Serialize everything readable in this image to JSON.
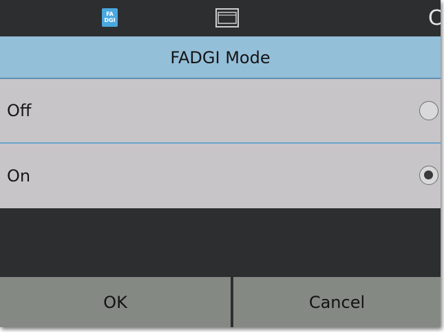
{
  "status_bar": {
    "fadgi_badge_line1": "FA",
    "fadgi_badge_line2": "DGI",
    "frame_icon": "frame-icon",
    "right_char": "C"
  },
  "dialog": {
    "title": "FADGI Mode",
    "options": [
      {
        "label": "Off",
        "selected": false
      },
      {
        "label": "On",
        "selected": true
      }
    ]
  },
  "buttons": {
    "ok": "OK",
    "cancel": "Cancel"
  },
  "colors": {
    "title_bar": "#94bfd9",
    "option_bg": "#c7c5c8",
    "button_bg": "#858984",
    "background": "#2d2e30",
    "badge": "#4aa8e0"
  }
}
